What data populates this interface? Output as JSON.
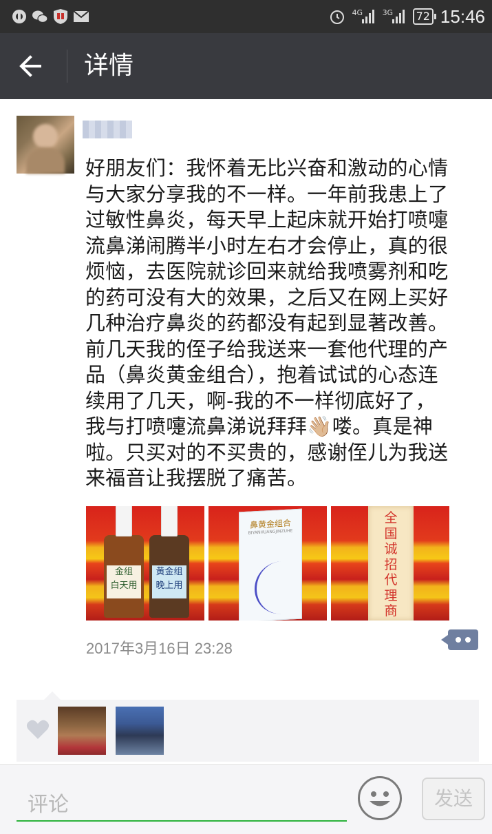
{
  "status_bar": {
    "time": "15:46",
    "battery": "72",
    "net1": "4G",
    "net2": "3G",
    "icons": [
      "settings-icon",
      "wechat-icon",
      "shield-icon",
      "mail-icon",
      "alarm-icon"
    ]
  },
  "header": {
    "title": "详情"
  },
  "post": {
    "text": "好朋友们：我怀着无比兴奋和激动的心情\n与大家分享我的不一样。一年前我患上了\n过敏性鼻炎，每天早上起床就开始打喷嚏\n流鼻涕闹腾半小时左右才会停止，真的很\n烦恼，去医院就诊回来就给我喷雾剂和吃\n的药可没有大的效果，之后又在网上买好\n几种治疗鼻炎的药都没有起到显著改善。\n前几天我的侄子给我送来一套他代理的产\n品（鼻炎黄金组合），抱着试试的心态连\n续用了几天，啊-我的不一样彻底好了，\n我与打喷嚏流鼻涕说拜拜👋🏼喽。真是神\n啦。只买对的不买贵的，感谢侄儿为我送\n来福音让我摆脱了痛苦。",
    "photo1_left_label": "金组\n白天用",
    "photo1_right_label": "黄金组\n晚上用",
    "photo2_box_title": "鼻黄金组合",
    "photo2_box_sub": "BIYANHUANGJINZUHE",
    "photo3_banner": "全国诚招代理商",
    "timestamp": "2017年3月16日 23:28"
  },
  "comment": {
    "placeholder": "评论",
    "send_label": "发送"
  },
  "colors": {
    "title_bar": "#393a3f",
    "status_bar": "#2f2f2f",
    "accent_green": "#2ab23a",
    "more_button": "#6f7fa0"
  }
}
